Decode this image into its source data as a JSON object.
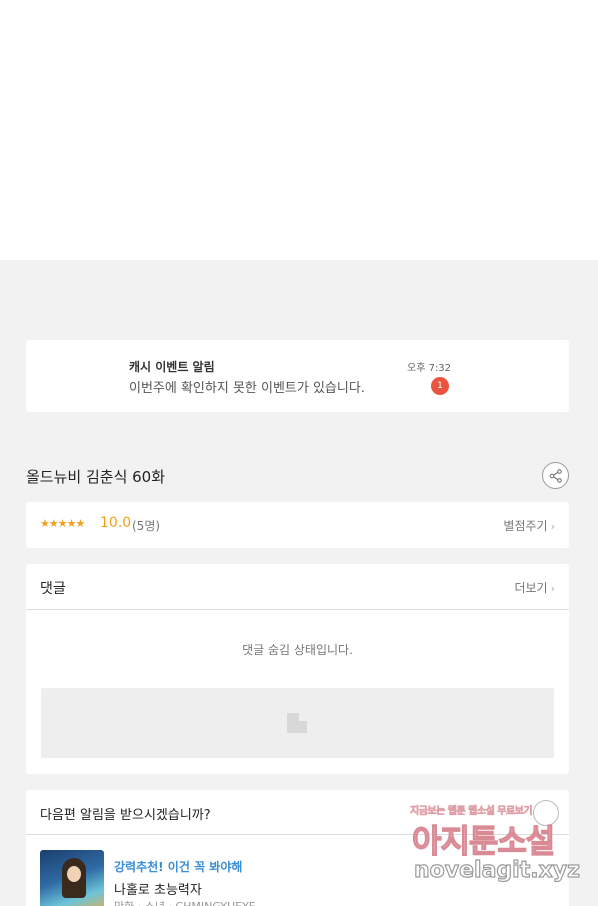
{
  "notification": {
    "title": "캐시 이벤트 알림",
    "message": "이번주에 확인하지 못한 이벤트가 있습니다.",
    "time": "오후 7:32",
    "badge_count": "1"
  },
  "episode": {
    "title": "올드뉴비 김춘식 60화"
  },
  "rating": {
    "stars": "★★★★★",
    "score": "10.0",
    "voters": "(5명)",
    "rate_link": "별점주기",
    "star_color": "#f0a020"
  },
  "comments": {
    "title": "댓글",
    "more_label": "더보기",
    "status_text": "댓글 숨김 상태입니다."
  },
  "subscribe": {
    "question": "다음편 알림을 받으시겠습니까?"
  },
  "recommendation": {
    "tag": "강력추천! 이건 꼭 봐야해",
    "title": "나홀로 초능력자",
    "meta": "만화 · 소년 · CHMINGYUEYE",
    "tag_color": "#3a8ed8"
  },
  "watermark": {
    "tagline": "지금보는 웹툰 웹소설 무료보기",
    "site_name": "아지툰소설",
    "url": "novelagit.xyz"
  },
  "icons": [
    "share-icon",
    "chevron-right-icon",
    "image-placeholder-icon",
    "bell-toggle-icon"
  ]
}
